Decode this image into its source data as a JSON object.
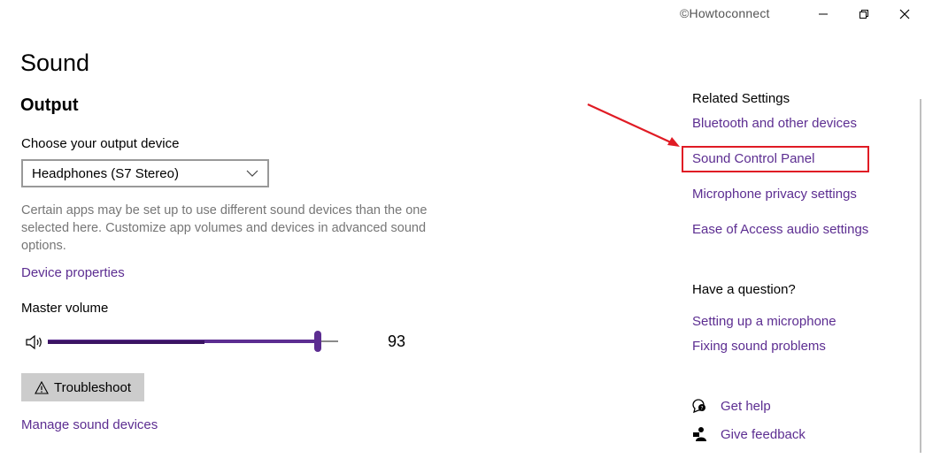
{
  "watermark": "©Howtoconnect",
  "window": {
    "minimize": "minimize",
    "maximize": "restore",
    "close": "close"
  },
  "page": {
    "title": "Sound"
  },
  "output": {
    "section_title": "Output",
    "choose_label": "Choose your output device",
    "selected_device": "Headphones (S7 Stereo)",
    "description": "Certain apps may be set up to use different sound devices than the one selected here. Customize app volumes and devices in advanced sound options.",
    "device_properties_link": "Device properties",
    "master_volume_label": "Master volume",
    "volume": 93,
    "volume_display": "93",
    "troubleshoot_label": "Troubleshoot",
    "manage_devices_link": "Manage sound devices"
  },
  "related": {
    "title": "Related Settings",
    "links": [
      "Bluetooth and other devices",
      "Sound Control Panel",
      "Microphone privacy settings",
      "Ease of Access audio settings"
    ],
    "highlighted": "Sound Control Panel"
  },
  "question": {
    "title": "Have a question?",
    "links": [
      "Setting up a microphone",
      "Fixing sound problems"
    ]
  },
  "support": {
    "get_help": "Get help",
    "give_feedback": "Give feedback"
  },
  "colors": {
    "accent": "#5c2d91",
    "highlight": "#e01b24",
    "secondary_text": "#767676"
  },
  "icons": [
    "minimize-icon",
    "restore-icon",
    "close-icon",
    "chevron-down-icon",
    "speaker-icon",
    "warning-icon",
    "help-icon",
    "feedback-icon",
    "red-arrow"
  ]
}
